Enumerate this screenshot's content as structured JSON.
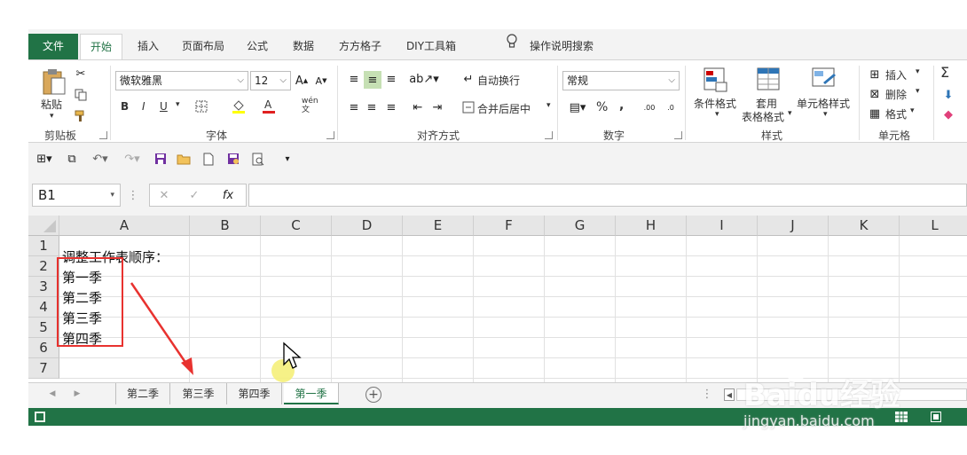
{
  "tabs": {
    "file": "文件",
    "home": "开始",
    "insert": "插入",
    "page_layout": "页面布局",
    "formulas": "公式",
    "data": "数据",
    "fangfang": "方方格子",
    "diy": "DIY工具箱",
    "tell_me": "操作说明搜索"
  },
  "ribbon": {
    "paste": "粘贴",
    "clipboard": "剪贴板",
    "font_name": "微软雅黑",
    "font_size": "12",
    "font_group": "字体",
    "bold": "B",
    "italic": "I",
    "underline": "U",
    "wen": "wén\n文",
    "wrap_text": "自动换行",
    "merge_center": "合并后居中",
    "alignment": "对齐方式",
    "number_format": "常规",
    "number_group": "数字",
    "percent": "%",
    "comma": ",",
    "cond_format": "条件格式",
    "table_format_line1": "套用",
    "table_format_line2": "表格格式",
    "cell_styles": "单元格样式",
    "styles_group": "样式",
    "insert": "插入",
    "delete": "删除",
    "format": "格式",
    "cells_group": "单元格",
    "sigma": "Σ"
  },
  "formula_bar": {
    "name_box": "B1",
    "fx": "fx"
  },
  "columns": [
    "A",
    "B",
    "C",
    "D",
    "E",
    "F",
    "G",
    "H",
    "I",
    "J",
    "K",
    "L"
  ],
  "rows": [
    "1",
    "2",
    "3",
    "4",
    "5",
    "6",
    "7"
  ],
  "cells": {
    "A1": "调整工作表顺序：",
    "A2": "第一季",
    "A3": "第二季",
    "A4": "第三季",
    "A5": "第四季"
  },
  "sheets": [
    "第二季",
    "第三季",
    "第四季",
    "第一季"
  ],
  "active_sheet": "第一季",
  "colors": {
    "accent": "#217346",
    "annotation_red": "#e8322f",
    "cursor_highlight": "#f5f07a"
  },
  "watermark": {
    "logo": "Baidu经验",
    "url": "jingyan.baidu.com"
  }
}
